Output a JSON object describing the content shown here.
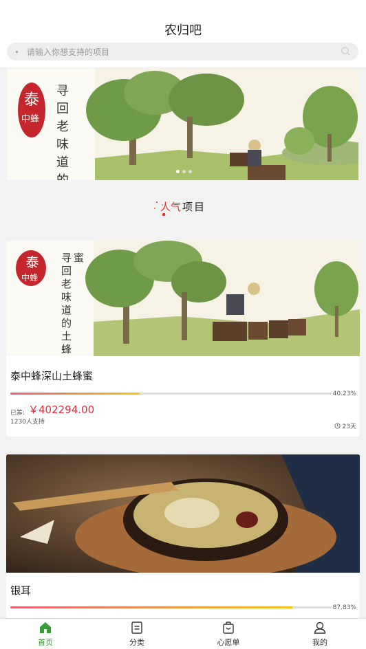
{
  "header": {
    "title": "农归吧",
    "search_placeholder": "请输入你想支持的项目"
  },
  "banner": {
    "caption": "寻回老味道的",
    "seal_text": "泰中蜂",
    "indicator_count": 3,
    "active_index": 0
  },
  "section": {
    "title_highlight": "人气",
    "title_rest": "项目"
  },
  "projects": [
    {
      "name": "泰中蜂深山土蜂蜜",
      "image_caption": "寻回老味道的土蜂蜜",
      "image_seal": "泰中蜂",
      "progress_fraction": 0.4023,
      "progress_text": "40.23%",
      "raised_label": "已筹:",
      "raised_amount": "￥402294.00",
      "supporters": "1230人支持",
      "days_left": "23天"
    },
    {
      "name": "银耳",
      "image_desc": "tremella soup",
      "progress_fraction": 0.8783,
      "progress_text": "87.83%"
    }
  ],
  "tabbar": {
    "items": [
      {
        "label": "首页",
        "icon": "home-icon",
        "active": true
      },
      {
        "label": "分类",
        "icon": "category-icon",
        "active": false
      },
      {
        "label": "心愿单",
        "icon": "bag-icon",
        "active": false
      },
      {
        "label": "我的",
        "icon": "user-icon",
        "active": false
      }
    ]
  },
  "colors": {
    "accent_green": "#3a9b3a",
    "price_red": "#e02d3c",
    "progress_start": "#e8607a",
    "progress_end": "#f5c21a"
  }
}
